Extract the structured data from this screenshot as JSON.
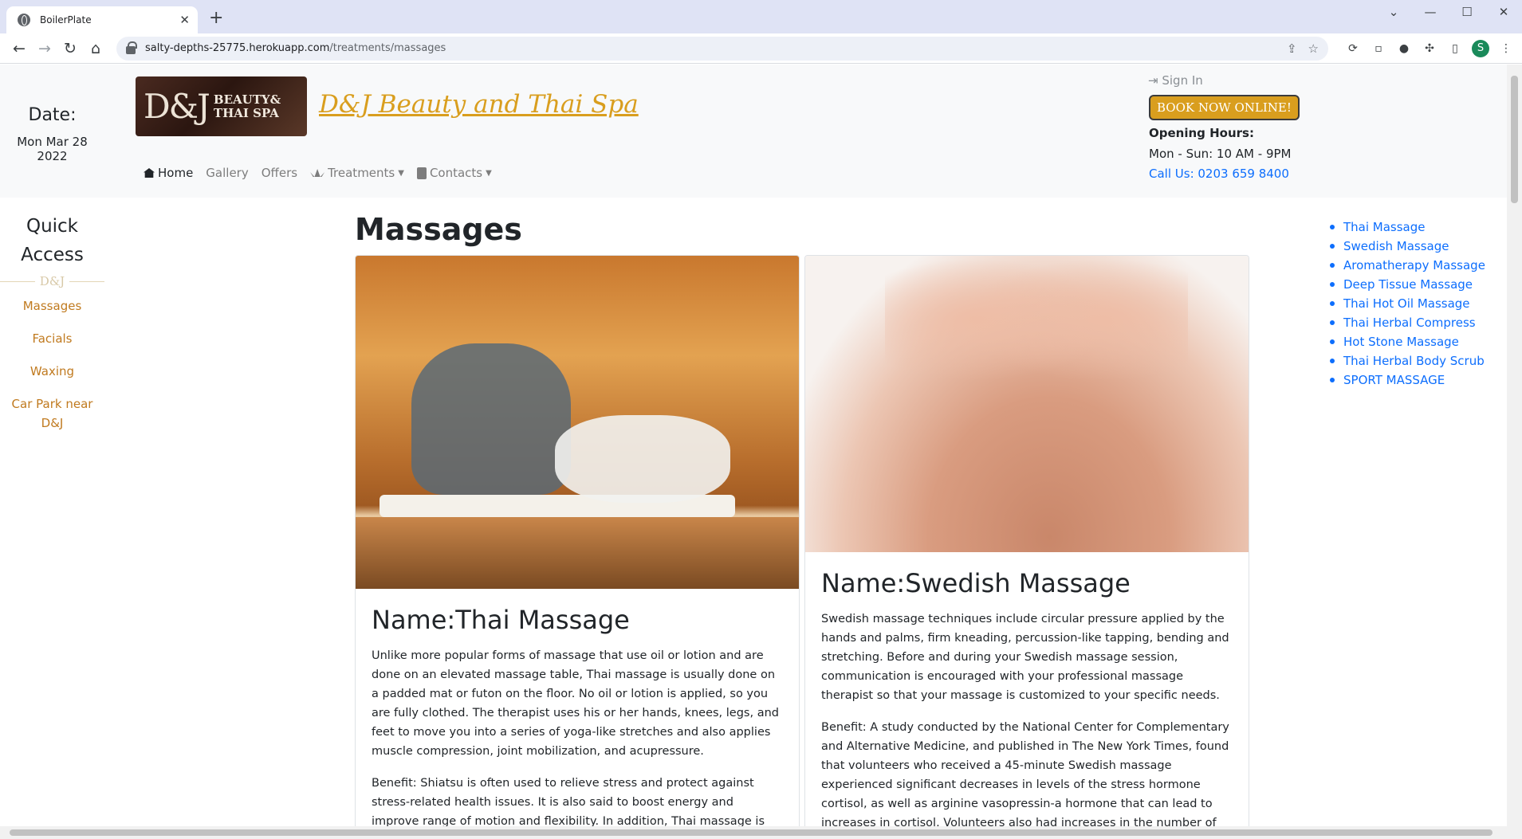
{
  "browser": {
    "tab_title": "BoilerPlate",
    "url_host": "salty-depths-25775.herokuapp.com",
    "url_path": "/treatments/massages",
    "profile_initial": "S"
  },
  "header": {
    "date_label": "Date:",
    "date_value": "Mon Mar 28 2022",
    "logo_mono": "D&J",
    "logo_word1": "BEAUTY&",
    "logo_word2": "THAI SPA",
    "site_title": " D&J Beauty and Thai Spa",
    "nav": {
      "home": "Home",
      "gallery": "Gallery",
      "offers": "Offers",
      "treatments": "Treatments",
      "contacts": "Contacts"
    },
    "sign_in": "Sign In",
    "book_now": "BOOK NOW ONLINE!",
    "hours_title": "Opening Hours:",
    "hours_value": "Mon - Sun: 10 AM - 9PM",
    "call_us": "Call Us: 0203 659 8400"
  },
  "sidebar": {
    "title_line1": "Quick",
    "title_line2": "Access",
    "divider": "D&J",
    "links": [
      "Massages",
      "Facials",
      "Waxing",
      "Car Park near D&J"
    ]
  },
  "main": {
    "heading": "Massages",
    "cards": [
      {
        "title": "Name:Thai Massage",
        "text1": "Unlike more popular forms of massage that use oil or lotion and are done on an elevated massage table, Thai massage is usually done on a padded mat or futon on the floor. No oil or lotion is applied, so you are fully clothed. The therapist uses his or her hands, knees, legs, and feet to move you into a series of yoga-like stretches and also applies muscle compression, joint mobilization, and acupressure.",
        "text2": "Benefit: Shiatsu is often used to relieve stress and protect against stress-related health issues. It is also said to boost energy and improve range of motion and flexibility. In addition, Thai massage is being explored as a"
      },
      {
        "title": "Name:Swedish Massage",
        "text1": "Swedish massage techniques include circular pressure applied by the hands and palms, firm kneading, percussion-like tapping, bending and stretching. Before and during your Swedish massage session, communication is encouraged with your professional massage therapist so that your massage is customized to your specific needs.",
        "text2": "Benefit: A study conducted by the National Center for Complementary and Alternative Medicine, and published in The New York Times, found that volunteers who received a 45-minute Swedish massage experienced significant decreases in levels of the stress hormone cortisol, as well as arginine vasopressin-a hormone that can lead to increases in cortisol. Volunteers also had increases in the number of lymphocytes, white blood"
      }
    ]
  },
  "toc": [
    "Thai Massage",
    "Swedish Massage",
    "Aromatherapy Massage",
    "Deep Tissue Massage",
    "Thai Hot Oil Massage",
    "Thai Herbal Compress",
    "Hot Stone Massage",
    "Thai Herbal Body Scrub",
    "SPORT MASSAGE"
  ]
}
